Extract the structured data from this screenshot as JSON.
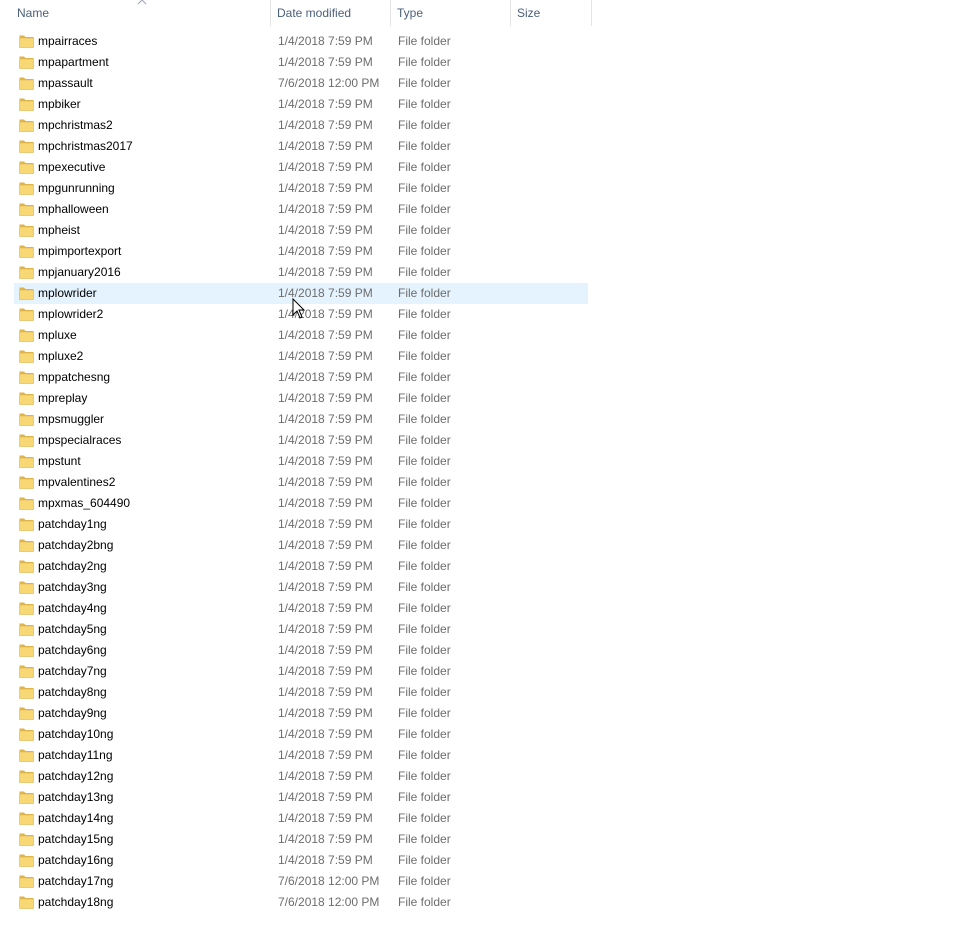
{
  "columns": {
    "name": "Name",
    "date": "Date modified",
    "type": "Type",
    "size": "Size"
  },
  "icons": {
    "folder": "folder-icon",
    "sort": "sort-ascending-icon",
    "cursor": "mouse-pointer-icon"
  },
  "colors": {
    "folder": "#f8d775",
    "hover": "#e5f3ff",
    "header_text": "#4c607a"
  },
  "hovered_index": 12,
  "rows": [
    {
      "name": "mpairraces",
      "date": "1/4/2018 7:59 PM",
      "type": "File folder"
    },
    {
      "name": "mpapartment",
      "date": "1/4/2018 7:59 PM",
      "type": "File folder"
    },
    {
      "name": "mpassault",
      "date": "7/6/2018 12:00 PM",
      "type": "File folder"
    },
    {
      "name": "mpbiker",
      "date": "1/4/2018 7:59 PM",
      "type": "File folder"
    },
    {
      "name": "mpchristmas2",
      "date": "1/4/2018 7:59 PM",
      "type": "File folder"
    },
    {
      "name": "mpchristmas2017",
      "date": "1/4/2018 7:59 PM",
      "type": "File folder"
    },
    {
      "name": "mpexecutive",
      "date": "1/4/2018 7:59 PM",
      "type": "File folder"
    },
    {
      "name": "mpgunrunning",
      "date": "1/4/2018 7:59 PM",
      "type": "File folder"
    },
    {
      "name": "mphalloween",
      "date": "1/4/2018 7:59 PM",
      "type": "File folder"
    },
    {
      "name": "mpheist",
      "date": "1/4/2018 7:59 PM",
      "type": "File folder"
    },
    {
      "name": "mpimportexport",
      "date": "1/4/2018 7:59 PM",
      "type": "File folder"
    },
    {
      "name": "mpjanuary2016",
      "date": "1/4/2018 7:59 PM",
      "type": "File folder"
    },
    {
      "name": "mplowrider",
      "date": "1/4/2018 7:59 PM",
      "type": "File folder"
    },
    {
      "name": "mplowrider2",
      "date": "1/4/2018 7:59 PM",
      "type": "File folder"
    },
    {
      "name": "mpluxe",
      "date": "1/4/2018 7:59 PM",
      "type": "File folder"
    },
    {
      "name": "mpluxe2",
      "date": "1/4/2018 7:59 PM",
      "type": "File folder"
    },
    {
      "name": "mppatchesng",
      "date": "1/4/2018 7:59 PM",
      "type": "File folder"
    },
    {
      "name": "mpreplay",
      "date": "1/4/2018 7:59 PM",
      "type": "File folder"
    },
    {
      "name": "mpsmuggler",
      "date": "1/4/2018 7:59 PM",
      "type": "File folder"
    },
    {
      "name": "mpspecialraces",
      "date": "1/4/2018 7:59 PM",
      "type": "File folder"
    },
    {
      "name": "mpstunt",
      "date": "1/4/2018 7:59 PM",
      "type": "File folder"
    },
    {
      "name": "mpvalentines2",
      "date": "1/4/2018 7:59 PM",
      "type": "File folder"
    },
    {
      "name": "mpxmas_604490",
      "date": "1/4/2018 7:59 PM",
      "type": "File folder"
    },
    {
      "name": "patchday1ng",
      "date": "1/4/2018 7:59 PM",
      "type": "File folder"
    },
    {
      "name": "patchday2bng",
      "date": "1/4/2018 7:59 PM",
      "type": "File folder"
    },
    {
      "name": "patchday2ng",
      "date": "1/4/2018 7:59 PM",
      "type": "File folder"
    },
    {
      "name": "patchday3ng",
      "date": "1/4/2018 7:59 PM",
      "type": "File folder"
    },
    {
      "name": "patchday4ng",
      "date": "1/4/2018 7:59 PM",
      "type": "File folder"
    },
    {
      "name": "patchday5ng",
      "date": "1/4/2018 7:59 PM",
      "type": "File folder"
    },
    {
      "name": "patchday6ng",
      "date": "1/4/2018 7:59 PM",
      "type": "File folder"
    },
    {
      "name": "patchday7ng",
      "date": "1/4/2018 7:59 PM",
      "type": "File folder"
    },
    {
      "name": "patchday8ng",
      "date": "1/4/2018 7:59 PM",
      "type": "File folder"
    },
    {
      "name": "patchday9ng",
      "date": "1/4/2018 7:59 PM",
      "type": "File folder"
    },
    {
      "name": "patchday10ng",
      "date": "1/4/2018 7:59 PM",
      "type": "File folder"
    },
    {
      "name": "patchday11ng",
      "date": "1/4/2018 7:59 PM",
      "type": "File folder"
    },
    {
      "name": "patchday12ng",
      "date": "1/4/2018 7:59 PM",
      "type": "File folder"
    },
    {
      "name": "patchday13ng",
      "date": "1/4/2018 7:59 PM",
      "type": "File folder"
    },
    {
      "name": "patchday14ng",
      "date": "1/4/2018 7:59 PM",
      "type": "File folder"
    },
    {
      "name": "patchday15ng",
      "date": "1/4/2018 7:59 PM",
      "type": "File folder"
    },
    {
      "name": "patchday16ng",
      "date": "1/4/2018 7:59 PM",
      "type": "File folder"
    },
    {
      "name": "patchday17ng",
      "date": "7/6/2018 12:00 PM",
      "type": "File folder"
    },
    {
      "name": "patchday18ng",
      "date": "7/6/2018 12:00 PM",
      "type": "File folder"
    }
  ]
}
